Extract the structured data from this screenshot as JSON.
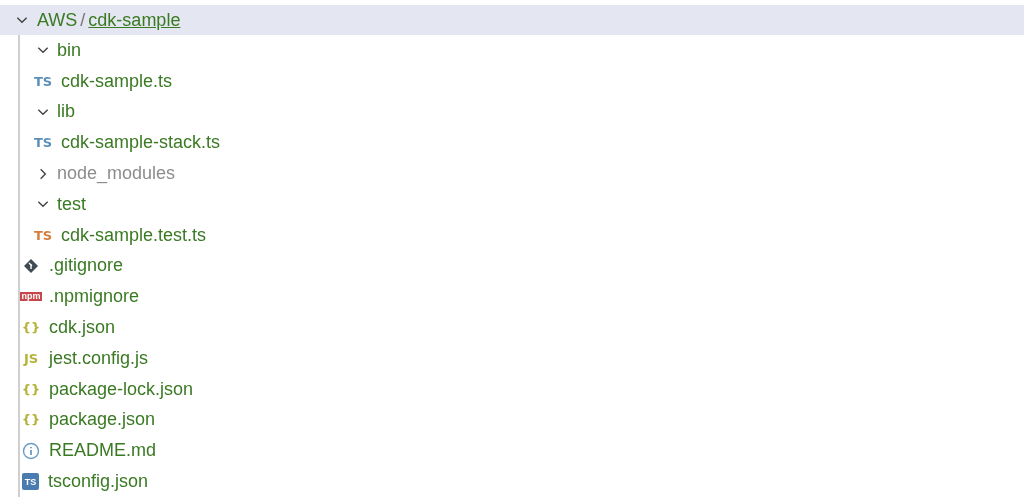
{
  "root": {
    "parent": "AWS",
    "separator": "/",
    "name": "cdk-sample",
    "expanded": true,
    "selected": true,
    "children": [
      {
        "kind": "folder",
        "name": "bin",
        "expanded": true,
        "ignored": false,
        "children": [
          {
            "kind": "file",
            "name": "cdk-sample.ts",
            "ignored": false,
            "icon": {
              "kind": "letters",
              "text": "TS",
              "color": "#5b8fb9"
            }
          }
        ]
      },
      {
        "kind": "folder",
        "name": "lib",
        "expanded": true,
        "ignored": false,
        "children": [
          {
            "kind": "file",
            "name": "cdk-sample-stack.ts",
            "ignored": false,
            "icon": {
              "kind": "letters",
              "text": "TS",
              "color": "#5b8fb9"
            }
          }
        ]
      },
      {
        "kind": "folder",
        "name": "node_modules",
        "expanded": false,
        "ignored": true
      },
      {
        "kind": "folder",
        "name": "test",
        "expanded": true,
        "ignored": false,
        "children": [
          {
            "kind": "file",
            "name": "cdk-sample.test.ts",
            "ignored": false,
            "icon": {
              "kind": "letters",
              "text": "TS",
              "color": "#d57d3d"
            }
          }
        ]
      },
      {
        "kind": "file",
        "name": ".gitignore",
        "ignored": false,
        "icon": {
          "kind": "git",
          "color": "#3f4b52"
        }
      },
      {
        "kind": "file",
        "name": ".npmignore",
        "ignored": false,
        "icon": {
          "kind": "badge",
          "text": "npm",
          "color": "#c6464a"
        }
      },
      {
        "kind": "file",
        "name": "cdk.json",
        "ignored": false,
        "icon": {
          "kind": "letters",
          "text": "{}",
          "color": "#b5b337"
        }
      },
      {
        "kind": "file",
        "name": "jest.config.js",
        "ignored": false,
        "icon": {
          "kind": "letters",
          "text": "JS",
          "color": "#b5b337"
        }
      },
      {
        "kind": "file",
        "name": "package-lock.json",
        "ignored": false,
        "icon": {
          "kind": "letters",
          "text": "{}",
          "color": "#b5b337"
        }
      },
      {
        "kind": "file",
        "name": "package.json",
        "ignored": false,
        "icon": {
          "kind": "letters",
          "text": "{}",
          "color": "#b5b337"
        }
      },
      {
        "kind": "file",
        "name": "README.md",
        "ignored": false,
        "icon": {
          "kind": "info",
          "color": "#6a9bc4"
        }
      },
      {
        "kind": "file",
        "name": "tsconfig.json",
        "ignored": false,
        "icon": {
          "kind": "box",
          "text": "TS",
          "color": "#4b7cb0"
        }
      }
    ]
  }
}
